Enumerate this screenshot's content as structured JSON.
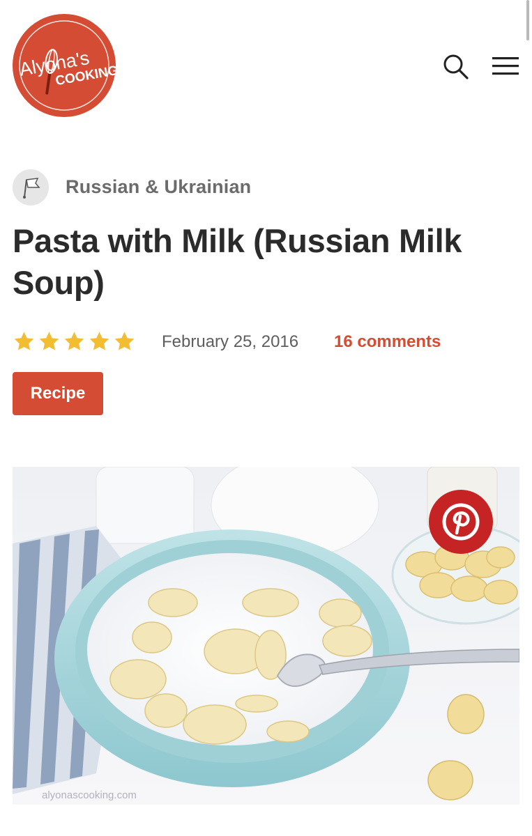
{
  "header": {
    "logo_line1": "Alyona's",
    "logo_line2": "COOKING",
    "search_icon": "search-icon",
    "menu_icon": "hamburger-menu-icon"
  },
  "article": {
    "category": "Russian & Ukrainian",
    "category_icon": "category-avatar-icon",
    "title": "Pasta with Milk (Russian Milk Soup)",
    "rating": 5,
    "rating_max": 5,
    "date": "February 25, 2016",
    "comments": "16 comments",
    "recipe_button": "Recipe"
  },
  "hero": {
    "watermark": "alyonascooking.com",
    "pin_icon": "pinterest-icon"
  },
  "colors": {
    "accent": "#d44c34",
    "pinterest": "#c62324",
    "star": "#f2bd30"
  }
}
